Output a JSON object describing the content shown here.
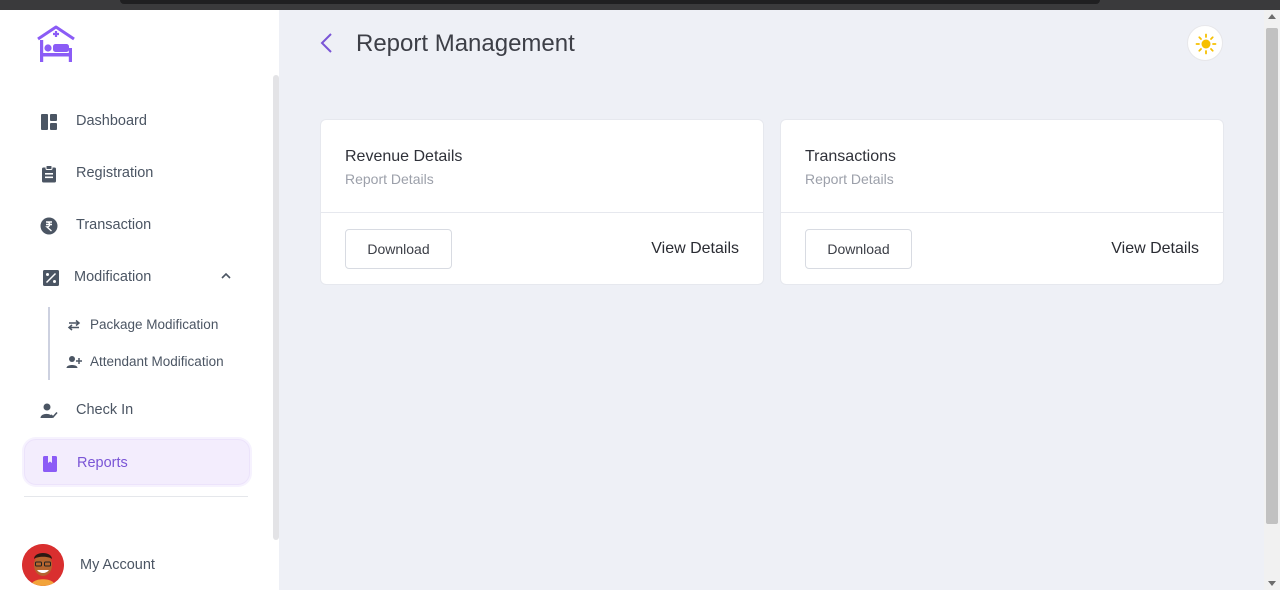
{
  "colors": {
    "accent": "#7a55d6",
    "sidebar_bg": "#ffffff",
    "main_bg": "#eef0f6"
  },
  "sidebar": {
    "items": [
      {
        "label": "Dashboard",
        "icon": "dashboard-icon"
      },
      {
        "label": "Registration",
        "icon": "clipboard-icon"
      },
      {
        "label": "Transaction",
        "icon": "rupee-icon"
      },
      {
        "label": "Modification",
        "icon": "percent-icon",
        "expanded": true
      },
      {
        "label": "Check In",
        "icon": "user-check-icon"
      },
      {
        "label": "Reports",
        "icon": "bookmark-icon",
        "active": true
      }
    ],
    "sub_items": [
      {
        "label": "Package Modification",
        "icon": "swap-arrows-icon"
      },
      {
        "label": "Attendant Modification",
        "icon": "user-plus-icon"
      }
    ],
    "account_label": "My Account"
  },
  "header": {
    "title": "Report Management"
  },
  "cards": [
    {
      "title": "Revenue Details",
      "subtitle": "Report Details",
      "download_label": "Download",
      "view_label": "View Details"
    },
    {
      "title": "Transactions",
      "subtitle": "Report Details",
      "download_label": "Download",
      "view_label": "View Details"
    }
  ]
}
